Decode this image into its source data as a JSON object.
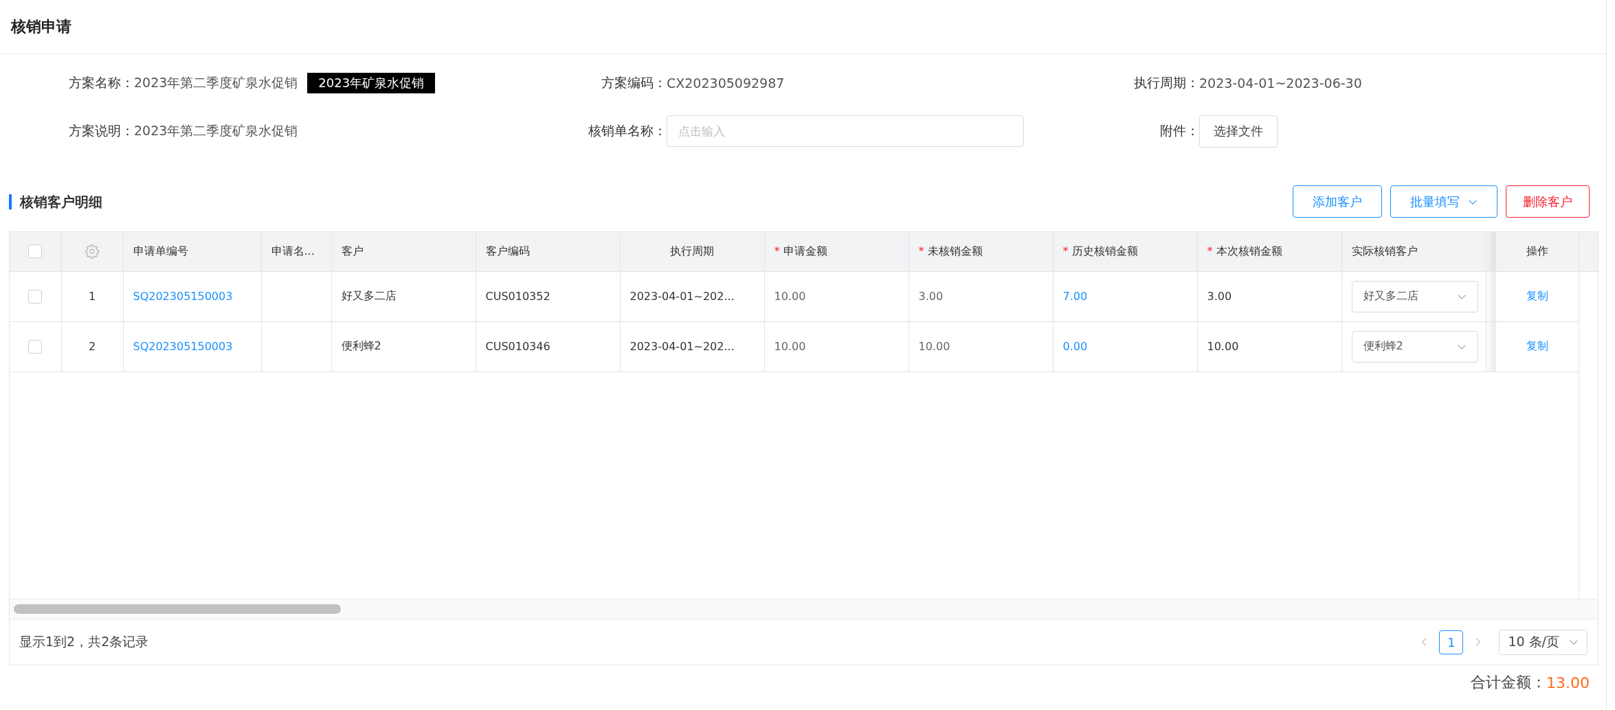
{
  "page": {
    "title": "核销申请"
  },
  "form": {
    "fields": [
      {
        "kind": "text",
        "label": "方案名称：",
        "value": "2023年第二季度矿泉水促销",
        "tag": "2023年矿泉水促销"
      },
      {
        "kind": "text",
        "label": "方案编码：",
        "value": "CX202305092987"
      },
      {
        "kind": "text",
        "label": "执行周期：",
        "value": "2023-04-01~2023-06-30"
      },
      {
        "kind": "text",
        "label": "方案说明：",
        "value": "2023年第二季度矿泉水促销"
      },
      {
        "kind": "input",
        "label": "核销单名称：",
        "placeholder": "点击输入"
      },
      {
        "kind": "file",
        "label": "附件：",
        "button": "选择文件"
      }
    ]
  },
  "section": {
    "title": "核销客户明细",
    "buttons": [
      {
        "label": "添加客户",
        "kind": "primary"
      },
      {
        "label": "批量填写",
        "kind": "dropdown"
      },
      {
        "label": "删除客户",
        "kind": "danger"
      }
    ]
  },
  "table": {
    "columns": [
      {
        "kind": "checkbox",
        "checked": false
      },
      {
        "kind": "settings"
      },
      {
        "kind": "text",
        "label": "申请单编号"
      },
      {
        "kind": "text",
        "label": "申请名..."
      },
      {
        "kind": "text",
        "label": "客户"
      },
      {
        "kind": "text",
        "label": "客户编码"
      },
      {
        "kind": "text",
        "label": "执行周期"
      },
      {
        "kind": "required",
        "label": "申请金额",
        "mark": "*"
      },
      {
        "kind": "required",
        "label": "未核销金额",
        "mark": "*"
      },
      {
        "kind": "required",
        "label": "历史核销金额",
        "mark": "*"
      },
      {
        "kind": "required",
        "label": "本次核销金额",
        "mark": "*"
      },
      {
        "kind": "text",
        "label": "实际核销客户"
      },
      {
        "kind": "text",
        "label": "操作"
      }
    ],
    "rows": [
      {
        "cells": [
          {
            "kind": "checkbox",
            "checked": false
          },
          {
            "kind": "index",
            "text": "1"
          },
          {
            "kind": "link",
            "text": "SQ202305150003"
          },
          {
            "kind": "empty"
          },
          {
            "kind": "text",
            "text": "好又多二店"
          },
          {
            "kind": "text",
            "text": "CUS010352"
          },
          {
            "kind": "text",
            "text": "2023-04-01~202..."
          },
          {
            "kind": "muted",
            "text": "10.00"
          },
          {
            "kind": "muted",
            "text": "3.00"
          },
          {
            "kind": "link",
            "text": "7.00"
          },
          {
            "kind": "text",
            "text": "3.00"
          },
          {
            "kind": "select",
            "text": "好又多二店"
          },
          {
            "kind": "action",
            "text": "复制"
          }
        ]
      },
      {
        "cells": [
          {
            "kind": "checkbox",
            "checked": false
          },
          {
            "kind": "index",
            "text": "2"
          },
          {
            "kind": "link",
            "text": "SQ202305150003"
          },
          {
            "kind": "empty"
          },
          {
            "kind": "text",
            "text": "便利蜂2"
          },
          {
            "kind": "text",
            "text": "CUS010346"
          },
          {
            "kind": "text",
            "text": "2023-04-01~202..."
          },
          {
            "kind": "muted",
            "text": "10.00"
          },
          {
            "kind": "muted",
            "text": "10.00"
          },
          {
            "kind": "link",
            "text": "0.00"
          },
          {
            "kind": "text",
            "text": "10.00"
          },
          {
            "kind": "select",
            "text": "便利蜂2"
          },
          {
            "kind": "action",
            "text": "复制"
          }
        ]
      }
    ]
  },
  "pager": {
    "summary": "显示1到2，共2条记录",
    "pages": [
      {
        "label": "1",
        "selected": true
      }
    ],
    "page_size": "10 条/页"
  },
  "total": {
    "label": "合计金额：",
    "value": "13.00"
  }
}
